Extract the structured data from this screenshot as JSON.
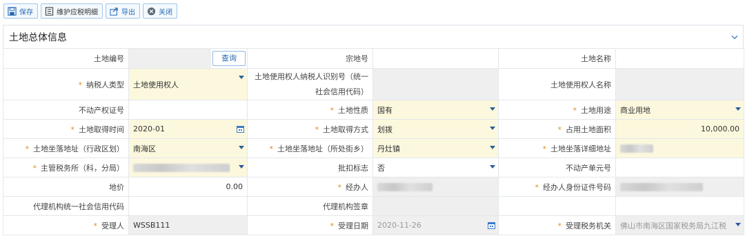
{
  "toolbar": {
    "save": "保存",
    "maintain": "维护应税明细",
    "export": "导出",
    "close": "关闭"
  },
  "panel": {
    "title": "土地总体信息"
  },
  "query_button": "查询",
  "labels": {
    "land_no": "土地编号",
    "parcel_no": "宗地号",
    "land_name": "土地名称",
    "taxpayer_type": "纳税人类型",
    "user_taxid": "土地使用权人纳税人识别号（统一社会信用代码）",
    "user_name": "土地使用权人名称",
    "property_cert": "不动产权证号",
    "land_nature": "土地性质",
    "land_use": "土地用途",
    "acquire_time": "土地取得时间",
    "acquire_method": "土地取得方式",
    "occupied_area": "占用土地面积",
    "addr_district": "土地坐落地址（行政区划）",
    "addr_street": "土地坐落地址（所处街乡）",
    "addr_detail": "土地坐落详细地址",
    "tax_office": "主管税务所（科，分局）",
    "withhold_flag": "批扣标志",
    "property_unit": "不动产单元号",
    "land_price": "地价",
    "handler": "经办人",
    "handler_id": "经办人身份证件号码",
    "agency_credit": "代理机构统一社会信用代码",
    "agency_seal": "代理机构签章",
    "receiver": "受理人",
    "receive_date": "受理日期",
    "receive_office": "受理税务机关"
  },
  "values": {
    "taxpayer_type": "土地使用权人",
    "land_nature": "国有",
    "land_use": "商业用地",
    "acquire_time": "2020-01",
    "acquire_method": "划拨",
    "occupied_area": "10,000.00",
    "addr_district": "南海区",
    "addr_street": "丹灶镇",
    "withhold_flag": "否",
    "land_price": "0.00",
    "receiver": "WSSB111",
    "receive_date": "2020-11-26",
    "receive_office": "佛山市南海区国家税务局九江税"
  }
}
